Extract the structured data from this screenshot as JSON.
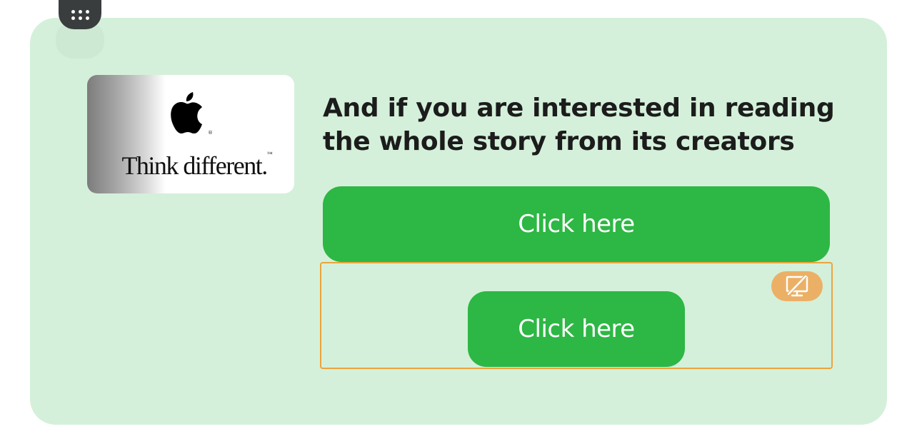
{
  "block": {
    "headline": "And if you are interested in reading the whole story from its creators",
    "image": {
      "tagline": "Think different.",
      "trademark": "™",
      "registered": "®"
    },
    "primary_button": {
      "label": "Click here"
    },
    "secondary_button": {
      "label": "Click here"
    }
  },
  "icons": {
    "drag_handle": "grip-dots-icon",
    "logo": "apple-logo-icon",
    "hide_on_desktop": "monitor-off-icon"
  },
  "colors": {
    "block_background": "#d4f0da",
    "button_green": "#2db744",
    "selection_orange": "#eba43f",
    "badge_orange": "#ebb066",
    "handle_dark": "#3a3d3d",
    "text_dark": "#1c1c1c"
  }
}
